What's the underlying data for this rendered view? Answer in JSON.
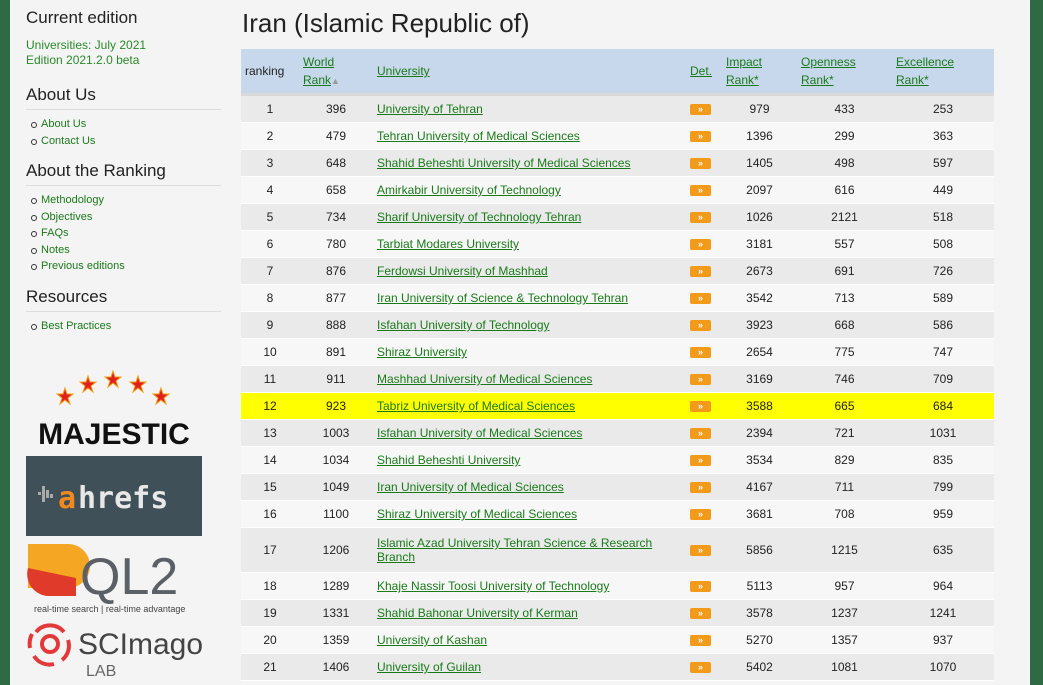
{
  "sidebar": {
    "current_edition_title": "Current edition",
    "edition_lines": [
      "Universities: July 2021",
      "Edition 2021.2.0 beta"
    ],
    "about_us_title": "About Us",
    "about_us_links": [
      "About Us",
      "Contact Us"
    ],
    "about_ranking_title": "About the Ranking",
    "about_ranking_links": [
      "Methodology",
      "Objectives",
      "FAQs",
      "Notes",
      "Previous editions"
    ],
    "resources_title": "Resources",
    "resources_links": [
      "Best Practices"
    ],
    "logos": {
      "majestic": "MAJESTIC",
      "ahrefs": "ahrefs",
      "ql2": "QL2",
      "ql2_tagline": "real-time search | real-time advantage",
      "scimago": "SCImago",
      "scimago_sub": "LAB"
    }
  },
  "main": {
    "title": "Iran (Islamic Republic of)",
    "headers": {
      "ranking": "ranking",
      "world_rank_1": "World",
      "world_rank_2": "Rank",
      "university": "University",
      "det": "Det.",
      "impact_1": "Impact",
      "impact_2": "Rank*",
      "openness_1": "Openness",
      "openness_2": "Rank*",
      "excellence_1": "Excellence",
      "excellence_2": "Rank*"
    },
    "det_button": "»",
    "rows": [
      {
        "ranking": "1",
        "world": "396",
        "university": "University of Tehran",
        "impact": "979",
        "openness": "433",
        "excellence": "253"
      },
      {
        "ranking": "2",
        "world": "479",
        "university": "Tehran University of Medical Sciences",
        "impact": "1396",
        "openness": "299",
        "excellence": "363"
      },
      {
        "ranking": "3",
        "world": "648",
        "university": "Shahid Beheshti University of Medical Sciences",
        "impact": "1405",
        "openness": "498",
        "excellence": "597"
      },
      {
        "ranking": "4",
        "world": "658",
        "university": "Amirkabir University of Technology",
        "impact": "2097",
        "openness": "616",
        "excellence": "449"
      },
      {
        "ranking": "5",
        "world": "734",
        "university": "Sharif University of Technology Tehran",
        "impact": "1026",
        "openness": "2121",
        "excellence": "518"
      },
      {
        "ranking": "6",
        "world": "780",
        "university": "Tarbiat Modares University",
        "impact": "3181",
        "openness": "557",
        "excellence": "508"
      },
      {
        "ranking": "7",
        "world": "876",
        "university": "Ferdowsi University of Mashhad",
        "impact": "2673",
        "openness": "691",
        "excellence": "726"
      },
      {
        "ranking": "8",
        "world": "877",
        "university": "Iran University of Science & Technology Tehran",
        "impact": "3542",
        "openness": "713",
        "excellence": "589"
      },
      {
        "ranking": "9",
        "world": "888",
        "university": "Isfahan University of Technology",
        "impact": "3923",
        "openness": "668",
        "excellence": "586"
      },
      {
        "ranking": "10",
        "world": "891",
        "university": "Shiraz University",
        "impact": "2654",
        "openness": "775",
        "excellence": "747"
      },
      {
        "ranking": "11",
        "world": "911",
        "university": "Mashhad University of Medical Sciences",
        "impact": "3169",
        "openness": "746",
        "excellence": "709"
      },
      {
        "ranking": "12",
        "world": "923",
        "university": "Tabriz University of Medical Sciences",
        "impact": "3588",
        "openness": "665",
        "excellence": "684",
        "highlighted": true
      },
      {
        "ranking": "13",
        "world": "1003",
        "university": "Isfahan University of Medical Sciences",
        "impact": "2394",
        "openness": "721",
        "excellence": "1031"
      },
      {
        "ranking": "14",
        "world": "1034",
        "university": "Shahid Beheshti University",
        "impact": "3534",
        "openness": "829",
        "excellence": "835"
      },
      {
        "ranking": "15",
        "world": "1049",
        "university": "Iran University of Medical Sciences",
        "impact": "4167",
        "openness": "711",
        "excellence": "799"
      },
      {
        "ranking": "16",
        "world": "1100",
        "university": "Shiraz University of Medical Sciences",
        "impact": "3681",
        "openness": "708",
        "excellence": "959"
      },
      {
        "ranking": "17",
        "world": "1206",
        "university": "Islamic Azad University Tehran Science & Research Branch",
        "impact": "5856",
        "openness": "1215",
        "excellence": "635"
      },
      {
        "ranking": "18",
        "world": "1289",
        "university": "Khaje Nassir Toosi University of Technology",
        "impact": "5113",
        "openness": "957",
        "excellence": "964"
      },
      {
        "ranking": "19",
        "world": "1331",
        "university": "Shahid Bahonar University of Kerman",
        "impact": "3578",
        "openness": "1237",
        "excellence": "1241"
      },
      {
        "ranking": "20",
        "world": "1359",
        "university": "University of Kashan",
        "impact": "5270",
        "openness": "1357",
        "excellence": "937"
      },
      {
        "ranking": "21",
        "world": "1406",
        "university": "University of Guilan",
        "impact": "5402",
        "openness": "1081",
        "excellence": "1070"
      }
    ]
  },
  "colors": {
    "frame": "#2e6b44",
    "link": "#1a7a1a",
    "header_bg": "#c8d8ec",
    "highlight": "#ffff00",
    "det_button": "#f29a1a"
  }
}
